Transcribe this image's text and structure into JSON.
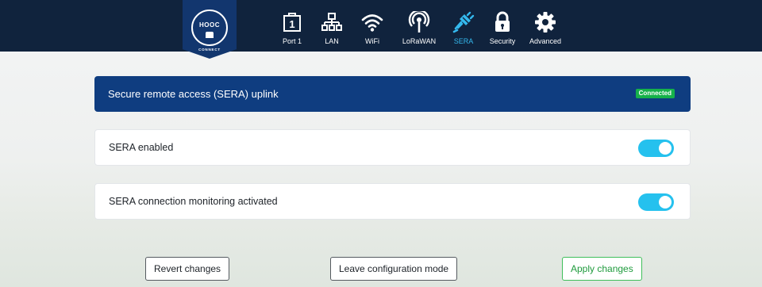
{
  "brand": {
    "name": "HOOC",
    "sub": "CONNECT"
  },
  "nav": [
    {
      "label": "Port 1",
      "icon": "port-icon",
      "active": false
    },
    {
      "label": "LAN",
      "icon": "network-icon",
      "active": false
    },
    {
      "label": "WiFi",
      "icon": "wifi-icon",
      "active": false
    },
    {
      "label": "LoRaWAN",
      "icon": "antenna-icon",
      "active": false
    },
    {
      "label": "SERA",
      "icon": "plug-icon",
      "active": true
    },
    {
      "label": "Security",
      "icon": "lock-icon",
      "active": false
    },
    {
      "label": "Advanced",
      "icon": "gear-icon",
      "active": false
    }
  ],
  "nav_port_number": "1",
  "header": {
    "title": "Secure remote access (SERA) uplink",
    "status": "Connected",
    "status_color": "#16b14a"
  },
  "settings": [
    {
      "label": "SERA enabled",
      "enabled": true
    },
    {
      "label": "SERA connection monitoring activated",
      "enabled": true
    }
  ],
  "buttons": {
    "revert": "Revert changes",
    "leave": "Leave configuration mode",
    "apply": "Apply changes"
  },
  "colors": {
    "topbar": "#10233d",
    "accent": "#34b9ee",
    "header_card": "#0f3d80",
    "toggle_on": "#25c1ee",
    "apply": "#3fbf5a"
  }
}
